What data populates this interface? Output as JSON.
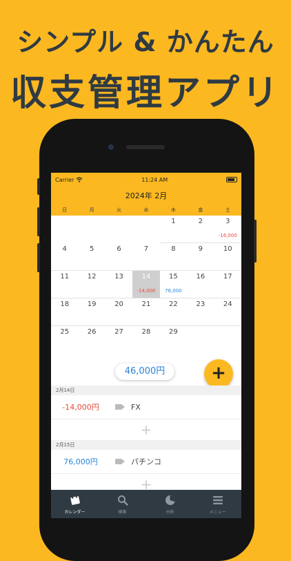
{
  "headline": {
    "line1": "シンプル & かんたん",
    "line2": "収支管理アプリ"
  },
  "status_bar": {
    "carrier": "Carrier",
    "time": "11:24 AM"
  },
  "calendar": {
    "title": "2024年 2月",
    "weekdays": [
      "日",
      "月",
      "火",
      "水",
      "木",
      "金",
      "土"
    ],
    "cells": [
      {
        "day": "",
        "amount": ""
      },
      {
        "day": "",
        "amount": ""
      },
      {
        "day": "",
        "amount": ""
      },
      {
        "day": "",
        "amount": ""
      },
      {
        "day": "1",
        "amount": ""
      },
      {
        "day": "2",
        "amount": ""
      },
      {
        "day": "3",
        "amount": "-16,000",
        "sign": "neg"
      },
      {
        "day": "4",
        "amount": ""
      },
      {
        "day": "5",
        "amount": ""
      },
      {
        "day": "6",
        "amount": ""
      },
      {
        "day": "7",
        "amount": ""
      },
      {
        "day": "8",
        "amount": ""
      },
      {
        "day": "9",
        "amount": ""
      },
      {
        "day": "10",
        "amount": ""
      },
      {
        "day": "11",
        "amount": ""
      },
      {
        "day": "12",
        "amount": ""
      },
      {
        "day": "13",
        "amount": ""
      },
      {
        "day": "14",
        "amount": "-14,000",
        "sign": "neg",
        "selected": true
      },
      {
        "day": "15",
        "amount": "76,000",
        "sign": "pos"
      },
      {
        "day": "16",
        "amount": ""
      },
      {
        "day": "17",
        "amount": ""
      },
      {
        "day": "18",
        "amount": ""
      },
      {
        "day": "19",
        "amount": ""
      },
      {
        "day": "20",
        "amount": ""
      },
      {
        "day": "21",
        "amount": ""
      },
      {
        "day": "22",
        "amount": ""
      },
      {
        "day": "23",
        "amount": ""
      },
      {
        "day": "24",
        "amount": ""
      },
      {
        "day": "25",
        "amount": ""
      },
      {
        "day": "26",
        "amount": ""
      },
      {
        "day": "27",
        "amount": ""
      },
      {
        "day": "28",
        "amount": ""
      },
      {
        "day": "29",
        "amount": ""
      },
      {
        "day": "",
        "amount": ""
      },
      {
        "day": "",
        "amount": ""
      }
    ]
  },
  "total": "46,000円",
  "add_button": "+",
  "entries": [
    {
      "date": "2月14日",
      "amount": "-14,000円",
      "sign": "neg",
      "category": "FX",
      "add": "+"
    },
    {
      "date": "2月15日",
      "amount": "76,000円",
      "sign": "pos",
      "category": "パチンコ",
      "add": "+"
    }
  ],
  "tabs": [
    {
      "label": "カレンダー",
      "icon": "calendar-icon",
      "active": true
    },
    {
      "label": "検索",
      "icon": "search-icon",
      "active": false
    },
    {
      "label": "分析",
      "icon": "pie-chart-icon",
      "active": false
    },
    {
      "label": "メニュー",
      "icon": "menu-icon",
      "active": false
    }
  ],
  "colors": {
    "brand": "#fbb820",
    "dark": "#2f3a42",
    "negative": "#e04b3a",
    "positive": "#2a83d8"
  }
}
